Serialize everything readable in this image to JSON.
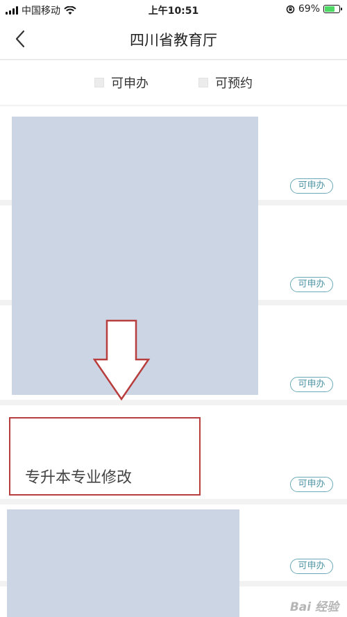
{
  "status_bar": {
    "carrier": "中国移动",
    "time": "上午10:51",
    "battery": "69%",
    "battery_level": 0.69
  },
  "nav": {
    "title": "四川省教育厅"
  },
  "filters": [
    {
      "label": "可申办"
    },
    {
      "label": "可预约"
    }
  ],
  "list": {
    "badge_label": "可申办",
    "highlighted_item": "专升本专业修改"
  },
  "watermark": "Bai 经验"
}
